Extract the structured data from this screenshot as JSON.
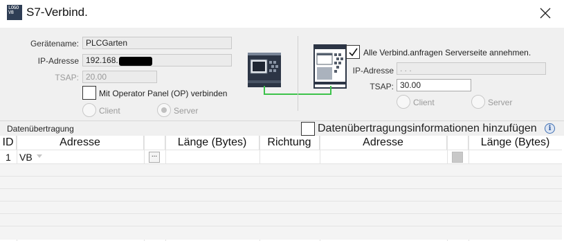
{
  "window": {
    "logo_lines": [
      "LOGO",
      "V8"
    ],
    "title": "S7-Verbind.",
    "close_icon": "close-icon"
  },
  "local": {
    "device_name_label": "Gerätename:",
    "device_name_value": "PLCGarten",
    "ip_label": "IP-Adresse",
    "ip_value": "192.168.",
    "tsap_label": "TSAP:",
    "tsap_value": "20.00",
    "op_panel_label": "Mit Operator Panel (OP) verbinden",
    "op_panel_checked": false,
    "client_label": "Client",
    "server_label": "Server",
    "selected_mode": "Server"
  },
  "remote": {
    "accept_all_label": "Alle Verbind.anfragen Serverseite annehmen.",
    "accept_all_checked": true,
    "ip_label": "IP-Adresse",
    "ip_value": " .  .  .",
    "tsap_label": "TSAP:",
    "tsap_value": "30.00",
    "client_label": "Client",
    "server_label": "Server"
  },
  "transfer": {
    "section_title": "Datenübertragung",
    "add_info_label": "Datenübertragungsinformationen hinzufügen",
    "add_info_checked": false,
    "info_icon": "i"
  },
  "table": {
    "columns": [
      "ID",
      "Adresse",
      "",
      "Länge (Bytes)",
      "Richtung",
      "Adresse",
      "",
      "Länge (Bytes)"
    ],
    "rows": [
      {
        "id": "1",
        "address": "VB",
        "browse": "...",
        "length": "",
        "direction": "",
        "remote_address": "",
        "remote_length": ""
      }
    ]
  },
  "colors": {
    "panel_bg": "#f0f0f0",
    "link_line": "#3cc24a",
    "device_dark": "#2c3545"
  }
}
